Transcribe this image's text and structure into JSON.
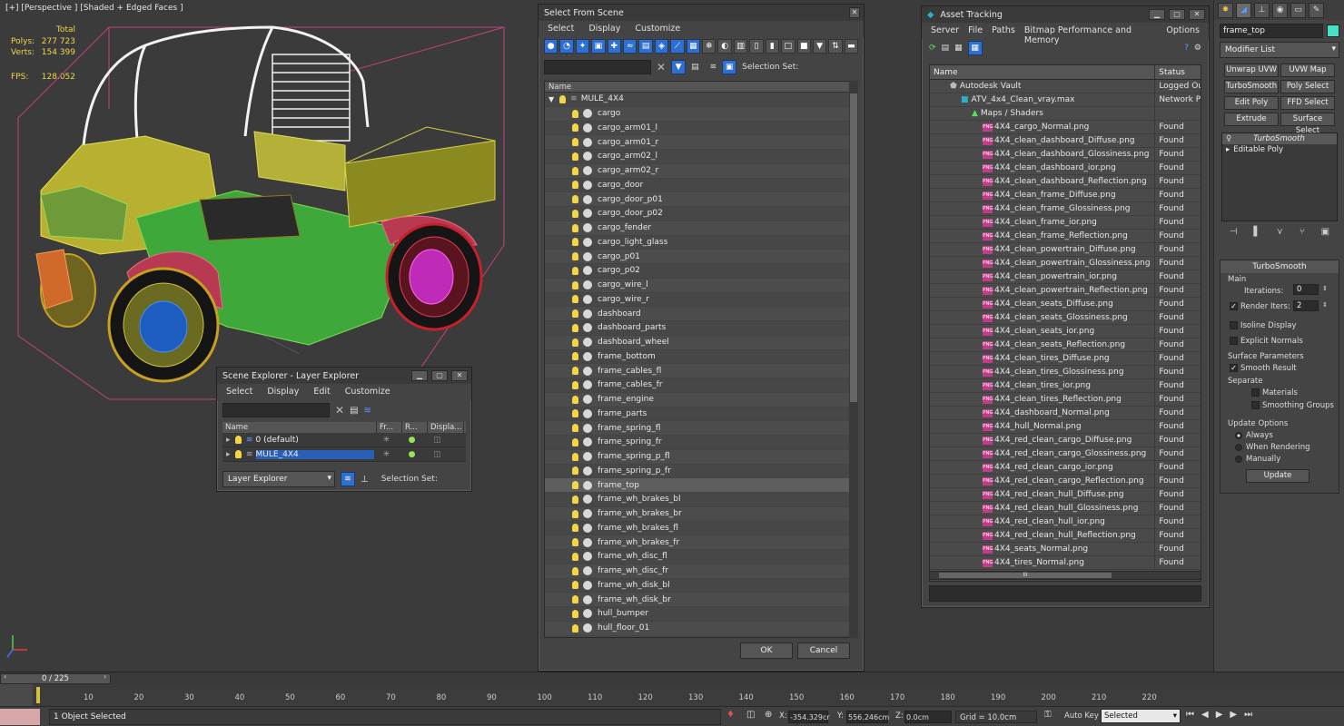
{
  "viewport": {
    "label": "[+] [Perspective ] [Shaded + Edged Faces ]",
    "stats": {
      "header": "Total",
      "polys_label": "Polys:",
      "polys": "277 723",
      "verts_label": "Verts:",
      "verts": "154 399",
      "fps_label": "FPS:",
      "fps": "128.052"
    }
  },
  "layer_explorer": {
    "title": "Scene Explorer - Layer Explorer",
    "menu": [
      "Select",
      "Display",
      "Edit",
      "Customize"
    ],
    "columns": [
      "Name",
      "Fr...",
      "R...",
      "Displa..."
    ],
    "layers": [
      {
        "name": "0 (default)",
        "selected": false
      },
      {
        "name": "MULE_4X4",
        "selected": true
      }
    ],
    "footer_dropdown": "Layer Explorer",
    "selection_set_label": "Selection Set:"
  },
  "select_scene": {
    "title": "Select From Scene",
    "menu": [
      "Select",
      "Display",
      "Customize"
    ],
    "selection_set_label": "Selection Set:",
    "column": "Name",
    "root": "MULE_4X4",
    "objects": [
      "cargo",
      "cargo_arm01_l",
      "cargo_arm01_r",
      "cargo_arm02_l",
      "cargo_arm02_r",
      "cargo_door",
      "cargo_door_p01",
      "cargo_door_p02",
      "cargo_fender",
      "cargo_light_glass",
      "cargo_p01",
      "cargo_p02",
      "cargo_wire_l",
      "cargo_wire_r",
      "dashboard",
      "dashboard_parts",
      "dashboard_wheel",
      "frame_bottom",
      "frame_cables_fl",
      "frame_cables_fr",
      "frame_engine",
      "frame_parts",
      "frame_spring_fl",
      "frame_spring_fr",
      "frame_spring_p_fl",
      "frame_spring_p_fr",
      "frame_top",
      "frame_wh_brakes_bl",
      "frame_wh_brakes_br",
      "frame_wh_brakes_fl",
      "frame_wh_brakes_fr",
      "frame_wh_disc_fl",
      "frame_wh_disc_fr",
      "frame_wh_disk_bl",
      "frame_wh_disk_br",
      "hull_bumper",
      "hull_floor_01"
    ],
    "selected_object": "frame_top",
    "ok_label": "OK",
    "cancel_label": "Cancel"
  },
  "asset_tracking": {
    "title": "Asset Tracking",
    "menu": [
      "Server",
      "File",
      "Paths",
      "Bitmap Performance and Memory",
      "Options"
    ],
    "col_name": "Name",
    "col_status": "Status",
    "vault": {
      "name": "Autodesk Vault",
      "status": "Logged Ou"
    },
    "file": {
      "name": "ATV_4x4_Clean_vray.max",
      "status": "Network Pa"
    },
    "group": "Maps / Shaders",
    "maps": [
      "4X4_cargo_Normal.png",
      "4X4_clean_dashboard_Diffuse.png",
      "4X4_clean_dashboard_Glossiness.png",
      "4X4_clean_dashboard_ior.png",
      "4X4_clean_dashboard_Reflection.png",
      "4X4_clean_frame_Diffuse.png",
      "4X4_clean_frame_Glossiness.png",
      "4X4_clean_frame_ior.png",
      "4X4_clean_frame_Reflection.png",
      "4X4_clean_powertrain_Diffuse.png",
      "4X4_clean_powertrain_Glossiness.png",
      "4X4_clean_powertrain_ior.png",
      "4X4_clean_powertrain_Reflection.png",
      "4X4_clean_seats_Diffuse.png",
      "4X4_clean_seats_Glossiness.png",
      "4X4_clean_seats_ior.png",
      "4X4_clean_seats_Reflection.png",
      "4X4_clean_tires_Diffuse.png",
      "4X4_clean_tires_Glossiness.png",
      "4X4_clean_tires_ior.png",
      "4X4_clean_tires_Reflection.png",
      "4X4_dashboard_Normal.png",
      "4X4_hull_Normal.png",
      "4X4_red_clean_cargo_Diffuse.png",
      "4X4_red_clean_cargo_Glossiness.png",
      "4X4_red_clean_cargo_ior.png",
      "4X4_red_clean_cargo_Reflection.png",
      "4X4_red_clean_hull_Diffuse.png",
      "4X4_red_clean_hull_Glossiness.png",
      "4X4_red_clean_hull_ior.png",
      "4X4_red_clean_hull_Reflection.png",
      "4X4_seats_Normal.png",
      "4X4_tires_Normal.png"
    ],
    "status_found": "Found",
    "scroll_mark": "III"
  },
  "command_panel": {
    "object_name": "frame_top",
    "modifier_list": "Modifier List",
    "buttons": [
      "Unwrap UVW",
      "UVW Map",
      "TurboSmooth",
      "Poly Select",
      "Edit Poly",
      "FFD Select",
      "Extrude",
      "Surface Select"
    ],
    "stack": [
      "TurboSmooth",
      "Editable Poly"
    ],
    "turbosmooth": {
      "title": "TurboSmooth",
      "main": "Main",
      "iterations_label": "Iterations:",
      "iterations": "0",
      "render_iters_label": "Render Iters:",
      "render_iters": "2",
      "isoline": "Isoline Display",
      "explicit": "Explicit Normals",
      "surface_params": "Surface Parameters",
      "smooth_result": "Smooth Result",
      "separate": "Separate",
      "materials": "Materials",
      "smoothing_groups": "Smoothing Groups",
      "update_options": "Update Options",
      "always": "Always",
      "when_rendering": "When Rendering",
      "manually": "Manually",
      "update_btn": "Update"
    }
  },
  "timeline": {
    "frame_counter": "0 / 225",
    "ticks": [
      "10",
      "20",
      "30",
      "40",
      "50",
      "60",
      "70",
      "80",
      "90",
      "100",
      "110",
      "120",
      "130",
      "140",
      "150",
      "160",
      "170",
      "180",
      "190",
      "200",
      "210",
      "220"
    ]
  },
  "status_bar": {
    "message": "1 Object Selected",
    "x_label": "X:",
    "x": "-354.329cr",
    "y_label": "Y:",
    "y": "556.246cm",
    "z_label": "Z:",
    "z": "0.0cm",
    "grid": "Grid = 10.0cm",
    "autokey": "Auto Key",
    "selected": "Selected"
  }
}
